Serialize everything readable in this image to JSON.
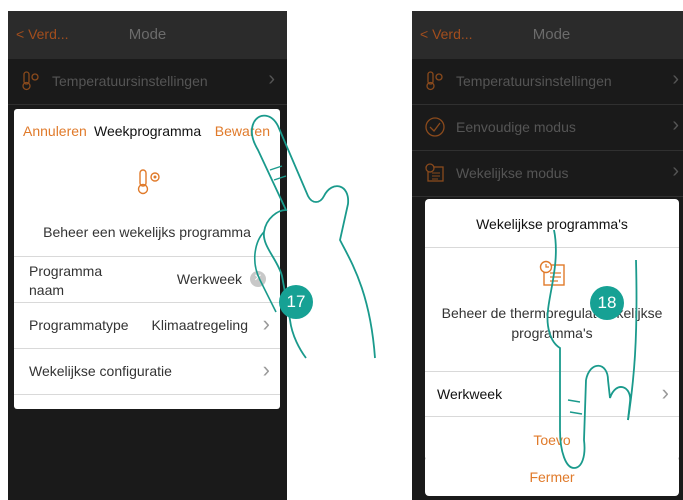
{
  "left_screen": {
    "topbar": {
      "back": "< Verd...",
      "title": "Mode"
    },
    "menu_row": {
      "label": "Temperatuursinstellingen"
    },
    "dialog": {
      "cancel": "Annuleren",
      "title": "Weekprogramma",
      "save": "Bewaren",
      "description": "Beheer een wekelijks programma",
      "rows": [
        {
          "label_line1": "Programma",
          "label_line2": "naam",
          "value": "Werkweek"
        },
        {
          "label": "Programmatype",
          "value": "Klimaatregeling"
        },
        {
          "label": "Wekelijkse configuratie"
        }
      ]
    },
    "step": "17"
  },
  "right_screen": {
    "topbar": {
      "back": "< Verd...",
      "title": "Mode"
    },
    "menu_rows": [
      {
        "label": "Temperatuursinstellingen"
      },
      {
        "label": "Eenvoudige modus"
      },
      {
        "label": "Wekelijkse modus"
      }
    ],
    "dialog": {
      "title": "Wekelijkse programma's",
      "description_line1": "Beheer de thermoregulat",
      "description_line1_end": "kelijkse",
      "description_line2": "programma's",
      "row": {
        "label": "Werkweek"
      },
      "add": "Toevo"
    },
    "close_button": "Fermer",
    "step": "18"
  },
  "colors": {
    "accent": "#e07a2a",
    "step_badge": "#16a194",
    "hand_outline": "#1a9a8c",
    "phone_bg": "#1a1a1a"
  }
}
